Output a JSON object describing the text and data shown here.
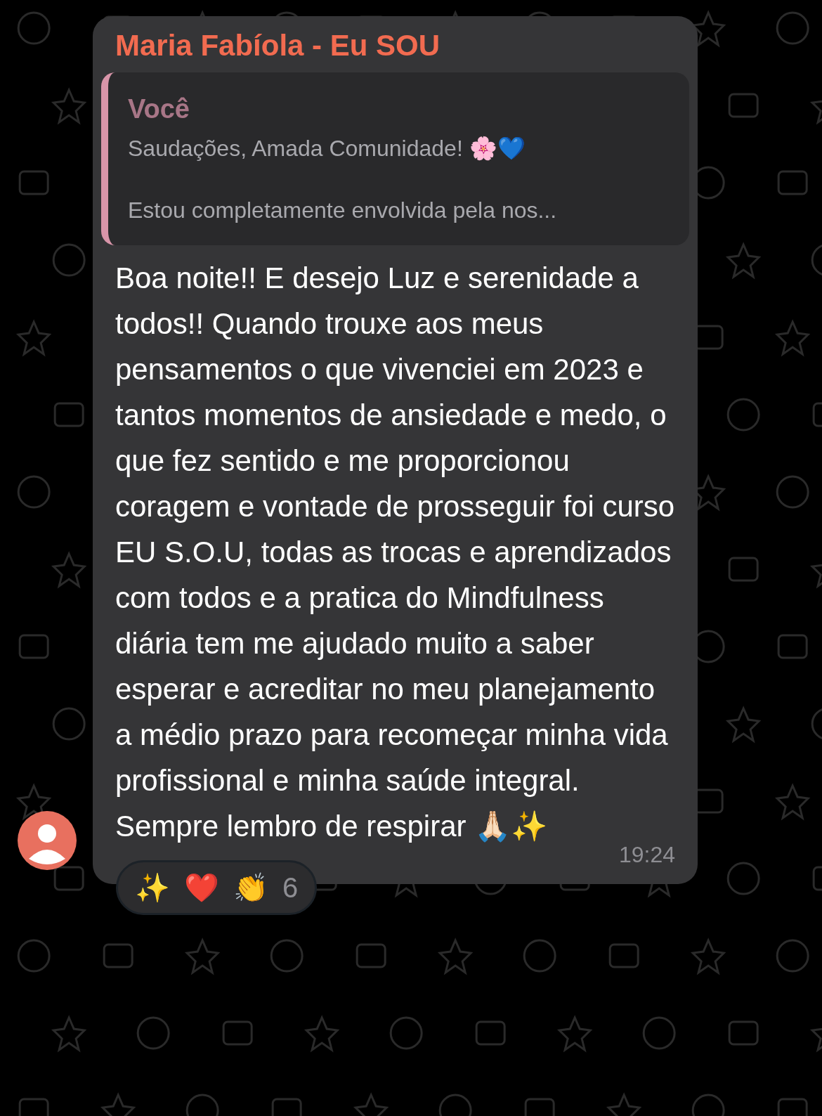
{
  "message": {
    "sender": "Maria Fabíola - Eu SOU",
    "quote": {
      "author": "Você",
      "paragraphs": [
        "Saudações, Amada Comunidade! 🌸💙",
        "Estou completamente envolvida pela nos..."
      ]
    },
    "text": "Boa noite!! E desejo Luz e serenidade a todos!! Quando trouxe aos meus pensamentos o que vivenciei em 2023 e tantos momentos de ansiedade e medo, o que fez sentido e me proporcionou coragem e vontade de prosseguir foi curso EU S.O.U, todas as trocas e aprendizados com todos e a pratica do Mindfulness diária tem me ajudado muito a saber esperar e acreditar no meu planejamento a médio prazo para recomeçar minha vida profissional e minha saúde integral. Sempre lembro de respirar 🙏🏻✨",
    "time": "19:24",
    "reactions": {
      "emojis": [
        "✨",
        "❤️",
        "👏"
      ],
      "count": "6"
    }
  }
}
